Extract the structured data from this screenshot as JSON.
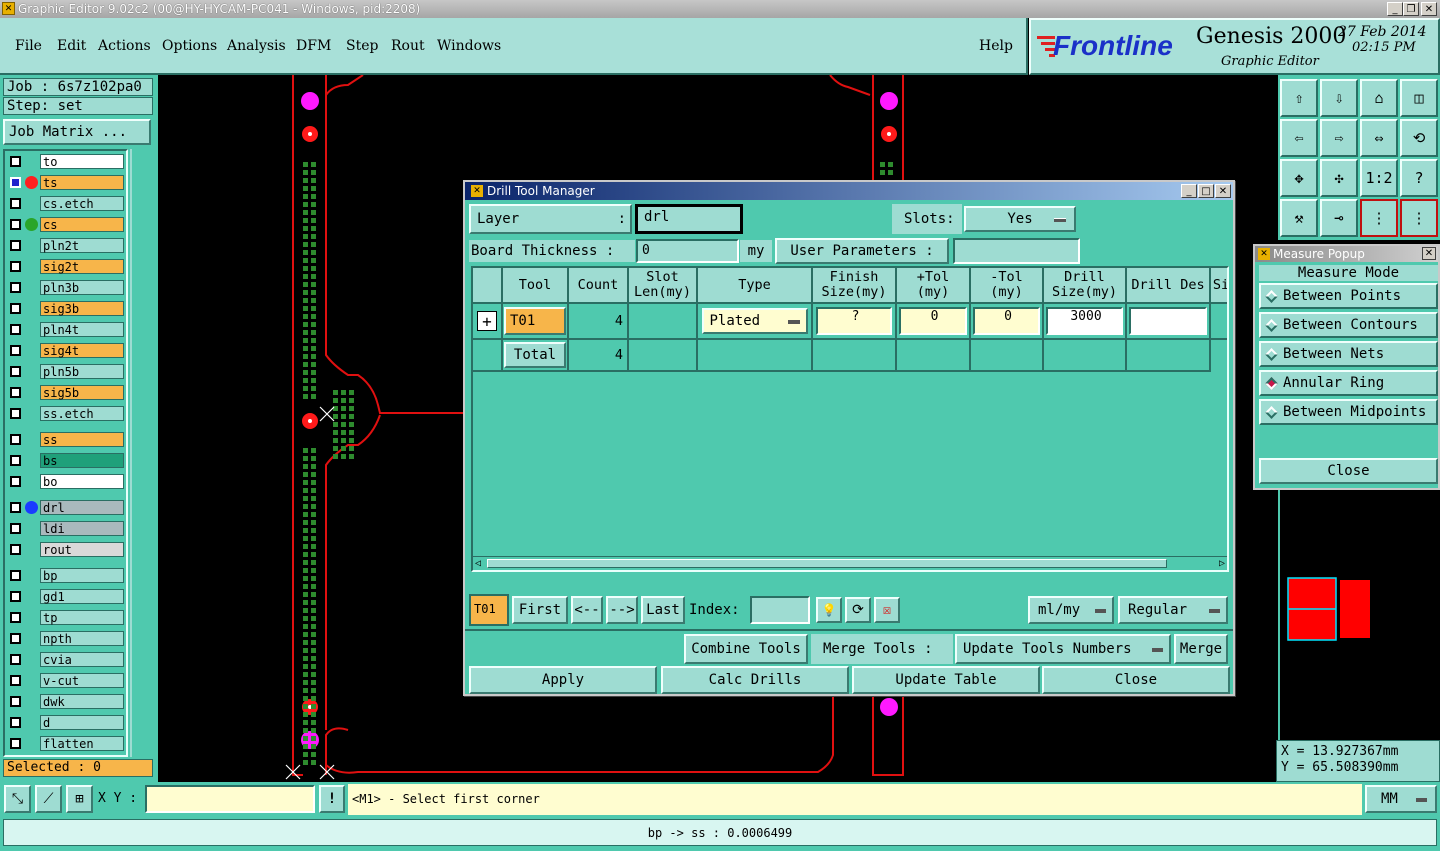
{
  "window": {
    "title": "Graphic Editor 9.02c2 (00@HY-HYCAM-PC041 - Windows, pid:2208)"
  },
  "menu": [
    "File",
    "Edit",
    "Actions",
    "Options",
    "Analysis",
    "DFM",
    "Step",
    "Rout",
    "Windows"
  ],
  "help": "Help",
  "brand": {
    "logo": "Frontline",
    "product": "Genesis 2000",
    "subtitle": "Graphic Editor",
    "date": "27 Feb 2014",
    "time": "02:15 PM"
  },
  "job": {
    "job_label": "Job : 6s7z102pa0",
    "step_label": "Step: set",
    "matrix_button": "Job Matrix ..."
  },
  "layers": [
    {
      "name": "to",
      "color": "#ffffff",
      "dot": ""
    },
    {
      "name": "ts",
      "color": "#f7b54a",
      "dot": "#ff2020",
      "active": true
    },
    {
      "name": "cs.etch",
      "color": "#9edcd2",
      "dot": ""
    },
    {
      "name": "cs",
      "color": "#f7b54a",
      "dot": "#2aa52a"
    },
    {
      "name": "pln2t",
      "color": "#9edcd2",
      "dot": ""
    },
    {
      "name": "sig2t",
      "color": "#f7b54a",
      "dot": ""
    },
    {
      "name": "pln3b",
      "color": "#9edcd2",
      "dot": ""
    },
    {
      "name": "sig3b",
      "color": "#f7b54a",
      "dot": ""
    },
    {
      "name": "pln4t",
      "color": "#9edcd2",
      "dot": ""
    },
    {
      "name": "sig4t",
      "color": "#f7b54a",
      "dot": ""
    },
    {
      "name": "pln5b",
      "color": "#9edcd2",
      "dot": ""
    },
    {
      "name": "sig5b",
      "color": "#f7b54a",
      "dot": ""
    },
    {
      "name": "ss.etch",
      "color": "#9edcd2",
      "dot": ""
    },
    {
      "name": "ss",
      "color": "#f7b54a",
      "dot": ""
    },
    {
      "name": "bs",
      "color": "#1fa07a",
      "dot": ""
    },
    {
      "name": "bo",
      "color": "#ffffff",
      "dot": ""
    },
    {
      "name": "drl",
      "color": "#a9b9bd",
      "dot": "#1a3cff"
    },
    {
      "name": "ldi",
      "color": "#a9b9bd",
      "dot": ""
    },
    {
      "name": "rout",
      "color": "#d9d9d9",
      "dot": ""
    },
    {
      "name": "bp",
      "color": "#9edcd2",
      "dot": ""
    },
    {
      "name": "gd1",
      "color": "#9edcd2",
      "dot": ""
    },
    {
      "name": "tp",
      "color": "#9edcd2",
      "dot": ""
    },
    {
      "name": "npth",
      "color": "#9edcd2",
      "dot": ""
    },
    {
      "name": "cvia",
      "color": "#9edcd2",
      "dot": ""
    },
    {
      "name": "v-cut",
      "color": "#9edcd2",
      "dot": ""
    },
    {
      "name": "dwk",
      "color": "#9edcd2",
      "dot": ""
    },
    {
      "name": "d",
      "color": "#9edcd2",
      "dot": ""
    },
    {
      "name": "flatten",
      "color": "#9edcd2",
      "dot": ""
    }
  ],
  "selected": "Selected : 0",
  "dialog": {
    "title": "Drill Tool Manager",
    "layer_label": "Layer :",
    "layer_value": "drl",
    "slots_label": "Slots:",
    "slots_value": "Yes",
    "board_thickness_label": "Board Thickness :",
    "board_thickness_value": "0",
    "board_thickness_unit": "my",
    "user_params_label": "User Parameters :",
    "user_params_value": "",
    "columns": [
      "Tool",
      "Count",
      "Slot Len(my)",
      "Type",
      "Finish Size(my)",
      "+Tol (my)",
      "-Tol (my)",
      "Drill Size(my)",
      "Drill Des",
      "Si"
    ],
    "rows": [
      {
        "tool": "T01",
        "count": "4",
        "slot": "",
        "type": "Plated",
        "finish": "?",
        "ptol": "0",
        "mtol": "0",
        "drill": "3000",
        "des": ""
      }
    ],
    "total_label": "Total",
    "total_count": "4",
    "nav": {
      "current": "T01",
      "first": "First",
      "prev": "<--",
      "next": "-->",
      "last": "Last",
      "index_label": "Index:",
      "index_value": "",
      "units": "ml/my",
      "mode": "Regular"
    },
    "combine": "Combine Tools",
    "merge_label": "Merge Tools :",
    "update_numbers": "Update Tools Numbers",
    "merge": "Merge",
    "apply": "Apply",
    "calc": "Calc Drills",
    "update_table": "Update Table",
    "close": "Close"
  },
  "measure": {
    "title": "Measure Popup",
    "mode_label": "Measure Mode",
    "options": [
      "Between Points",
      "Between Contours",
      "Between Nets",
      "Annular Ring",
      "Between Midpoints"
    ],
    "selected": "Annular Ring",
    "close": "Close"
  },
  "toolbox": [
    "⇧",
    "⇩",
    "⌂",
    "◫",
    "⇦",
    "⇨",
    "⇔",
    "⟲",
    "✥",
    "✣",
    "1:2",
    "?",
    "⚒",
    "⊸",
    "⋮",
    "⋮"
  ],
  "coords": {
    "x": "X = 13.927367mm",
    "y": "Y = 65.508390mm"
  },
  "bottom": {
    "xy_label": "X Y :",
    "xy_value": "",
    "warn": "!",
    "prompt": "<M1> - Select first corner",
    "units": "MM"
  },
  "status": "bp -> ss : 0.0006499"
}
